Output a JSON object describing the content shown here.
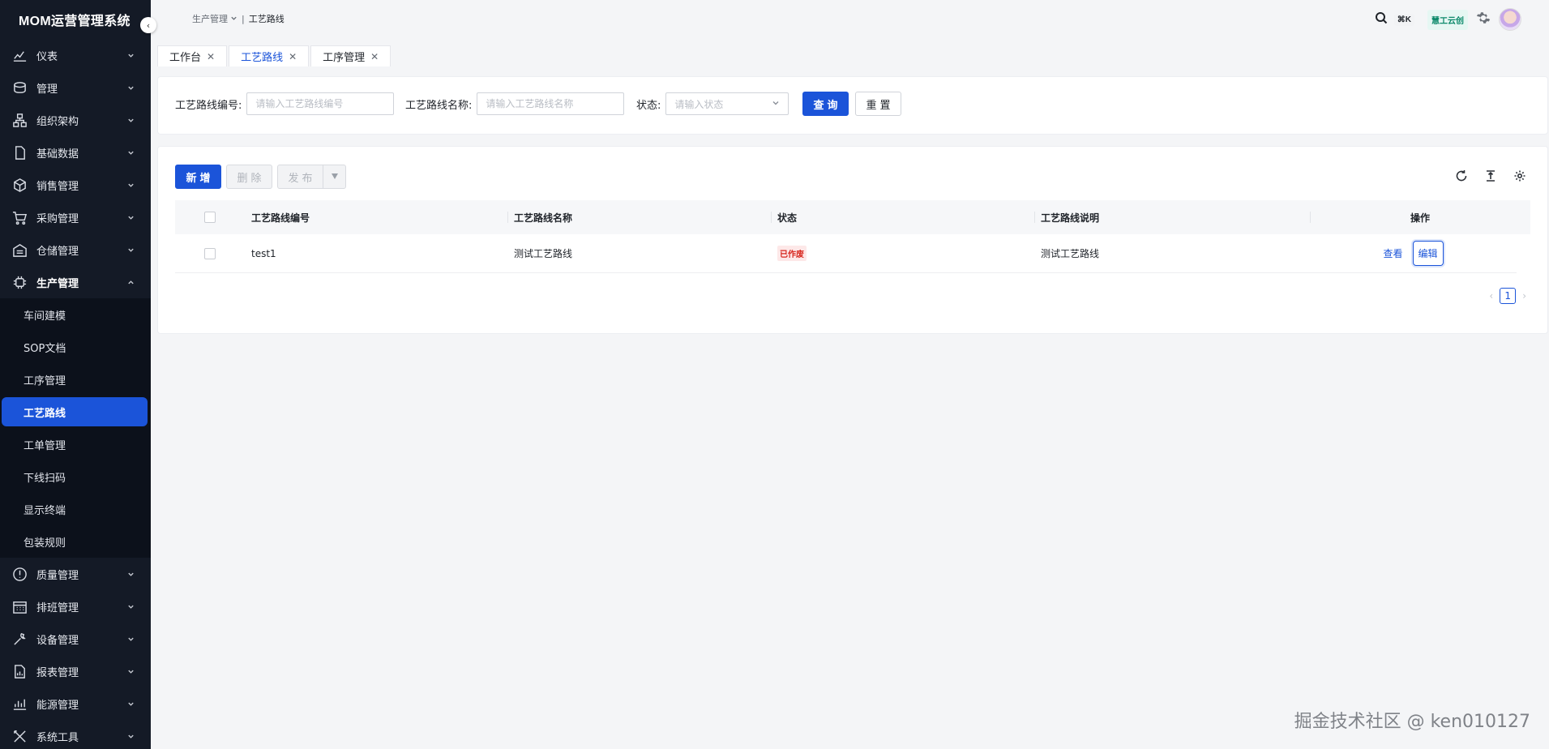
{
  "app": {
    "title": "MOM运营管理系统"
  },
  "sidebar": {
    "menu_top": [
      {
        "label": "仪表",
        "icon": "chart-icon"
      },
      {
        "label": "管理",
        "icon": "box-icon"
      },
      {
        "label": "组织架构",
        "icon": "org-icon"
      },
      {
        "label": "基础数据",
        "icon": "file-icon"
      },
      {
        "label": "销售管理",
        "icon": "cube-icon"
      },
      {
        "label": "采购管理",
        "icon": "cart-icon"
      },
      {
        "label": "仓储管理",
        "icon": "warehouse-icon"
      }
    ],
    "open_group": {
      "label": "生产管理",
      "icon": "chip-icon"
    },
    "submenu": [
      {
        "label": "车间建模"
      },
      {
        "label": "SOP文档"
      },
      {
        "label": "工序管理"
      },
      {
        "label": "工艺路线"
      },
      {
        "label": "工单管理"
      },
      {
        "label": "下线扫码"
      },
      {
        "label": "显示终端"
      },
      {
        "label": "包装规则"
      }
    ],
    "menu_bottom": [
      {
        "label": "质量管理",
        "icon": "alert-icon"
      },
      {
        "label": "排班管理",
        "icon": "calendar-icon"
      },
      {
        "label": "设备管理",
        "icon": "wrench-icon"
      },
      {
        "label": "报表管理",
        "icon": "report-icon"
      },
      {
        "label": "能源管理",
        "icon": "energy-icon"
      },
      {
        "label": "系统工具",
        "icon": "tools-icon"
      }
    ]
  },
  "header": {
    "breadcrumb": {
      "parent": "生产管理",
      "current": "工艺路线"
    },
    "shortcut": "⌘K",
    "brand": "慧工云创"
  },
  "tabs": [
    {
      "label": "工作台"
    },
    {
      "label": "工艺路线"
    },
    {
      "label": "工序管理"
    }
  ],
  "search": {
    "code_label": "工艺路线编号:",
    "code_placeholder": "请输入工艺路线编号",
    "name_label": "工艺路线名称:",
    "name_placeholder": "请输入工艺路线名称",
    "status_label": "状态:",
    "status_placeholder": "请输入状态",
    "query_button": "查询",
    "reset_button": "重置"
  },
  "toolbar": {
    "add_button": "新增",
    "delete_button": "删除",
    "publish_button": "发布"
  },
  "table": {
    "headers": [
      "工艺路线编号",
      "工艺路线名称",
      "状态",
      "工艺路线说明",
      "操作"
    ],
    "rows": [
      {
        "code": "test1",
        "name": "测试工艺路线",
        "status": "已作废",
        "desc": "测试工艺路线",
        "view": "查看",
        "edit": "编辑"
      }
    ]
  },
  "pagination": {
    "current_page": "1"
  },
  "watermark": "掘金技术社区 @ ken010127",
  "colors": {
    "primary": "#1b54d9",
    "sidebar_bg": "#141a26",
    "danger": "#d7261d"
  }
}
